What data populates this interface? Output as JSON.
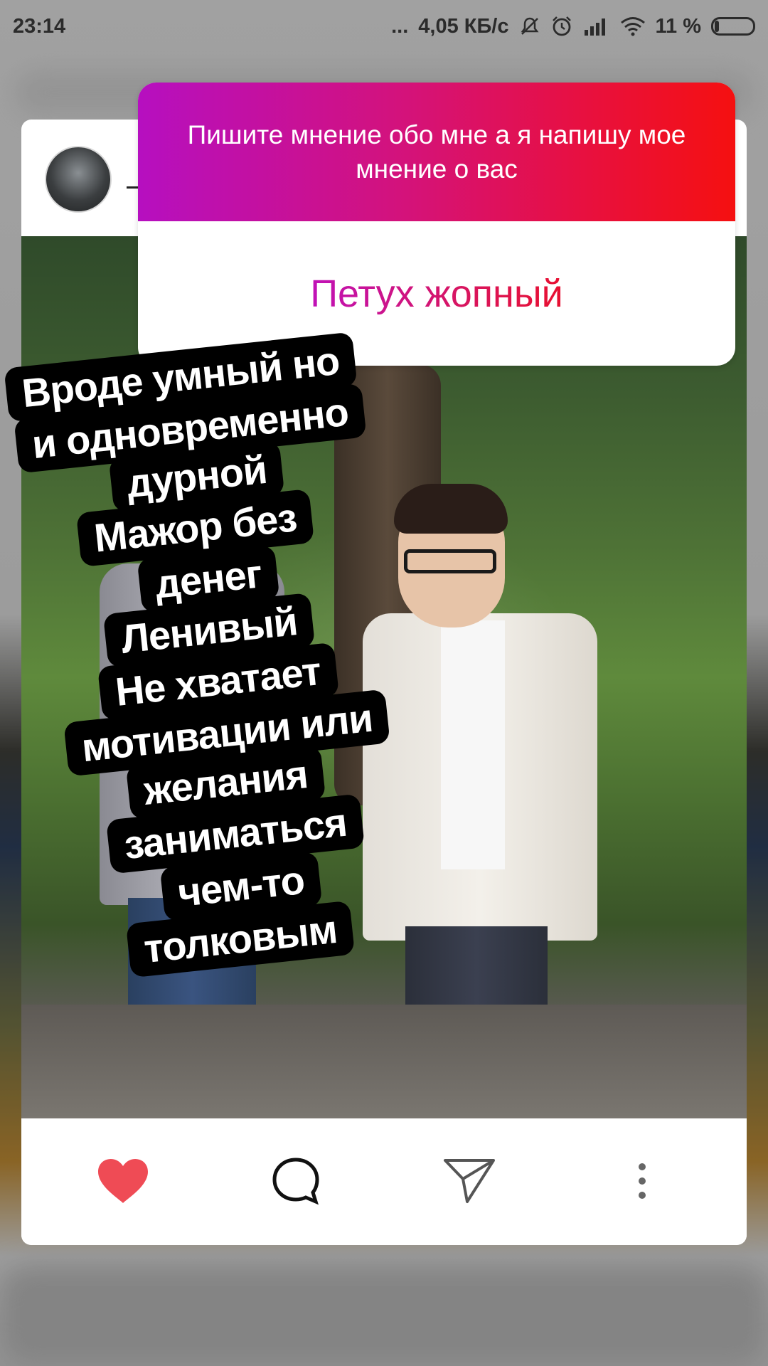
{
  "status_bar": {
    "time": "23:14",
    "dots": "...",
    "network_speed": "4,05 КБ/с",
    "battery_percent": "11 %"
  },
  "story": {
    "question_prompt": "Пишите мнение обо мне а я напишу мое мнение о вас",
    "question_answer": "Петух жопный",
    "caption_lines": [
      "Вроде умный но",
      "и одновременно",
      "дурной",
      "Мажор без",
      "денег",
      "Ленивый",
      "Не хватает",
      "мотивации или",
      "желания",
      "заниматься",
      "чем-то",
      "толковым"
    ]
  },
  "actions": {
    "like_icon": "heart-icon",
    "comment_icon": "comment-icon",
    "share_icon": "send-icon",
    "more_icon": "more-vertical-icon"
  },
  "colors": {
    "like": "#ef4b55",
    "gradient_start": "#b60fc0",
    "gradient_end": "#f51010"
  }
}
